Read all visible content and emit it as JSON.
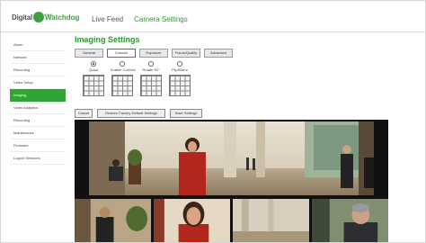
{
  "brand": {
    "name_part1": "Digital",
    "name_part2": "Watchdog",
    "sub": "IPRO"
  },
  "top_nav": {
    "live_feed": "Live Feed",
    "camera_settings": "Camera Settings"
  },
  "sidebar": {
    "items": [
      {
        "label": "Alarm"
      },
      {
        "label": "Network"
      },
      {
        "label": "Recording"
      },
      {
        "label": "Video Setup"
      },
      {
        "label": "Imaging"
      },
      {
        "label": "Video Analytics"
      },
      {
        "label": "Recording"
      },
      {
        "label": "Maintenance"
      },
      {
        "label": "Firmware"
      },
      {
        "label": "Logout Sessions"
      }
    ],
    "active_index": 4
  },
  "main": {
    "title": "Imaging Settings",
    "tabs": [
      "General",
      "Corridor",
      "Exposure",
      "Focus/Quality",
      "Advanced"
    ],
    "active_tab": 1,
    "modes": [
      {
        "label": "Quad",
        "checked": true
      },
      {
        "label": "Enable Corridor",
        "checked": false
      },
      {
        "label": "Rotate 90°",
        "checked": false
      },
      {
        "label": "Flip/Mirror",
        "checked": false
      }
    ],
    "buttons": {
      "cancel": "Cancel",
      "restore": "Restore Factory Default Settings",
      "save": "Save Settings"
    }
  },
  "colors": {
    "accent": "#2fa532",
    "title": "#2e9a2e"
  }
}
